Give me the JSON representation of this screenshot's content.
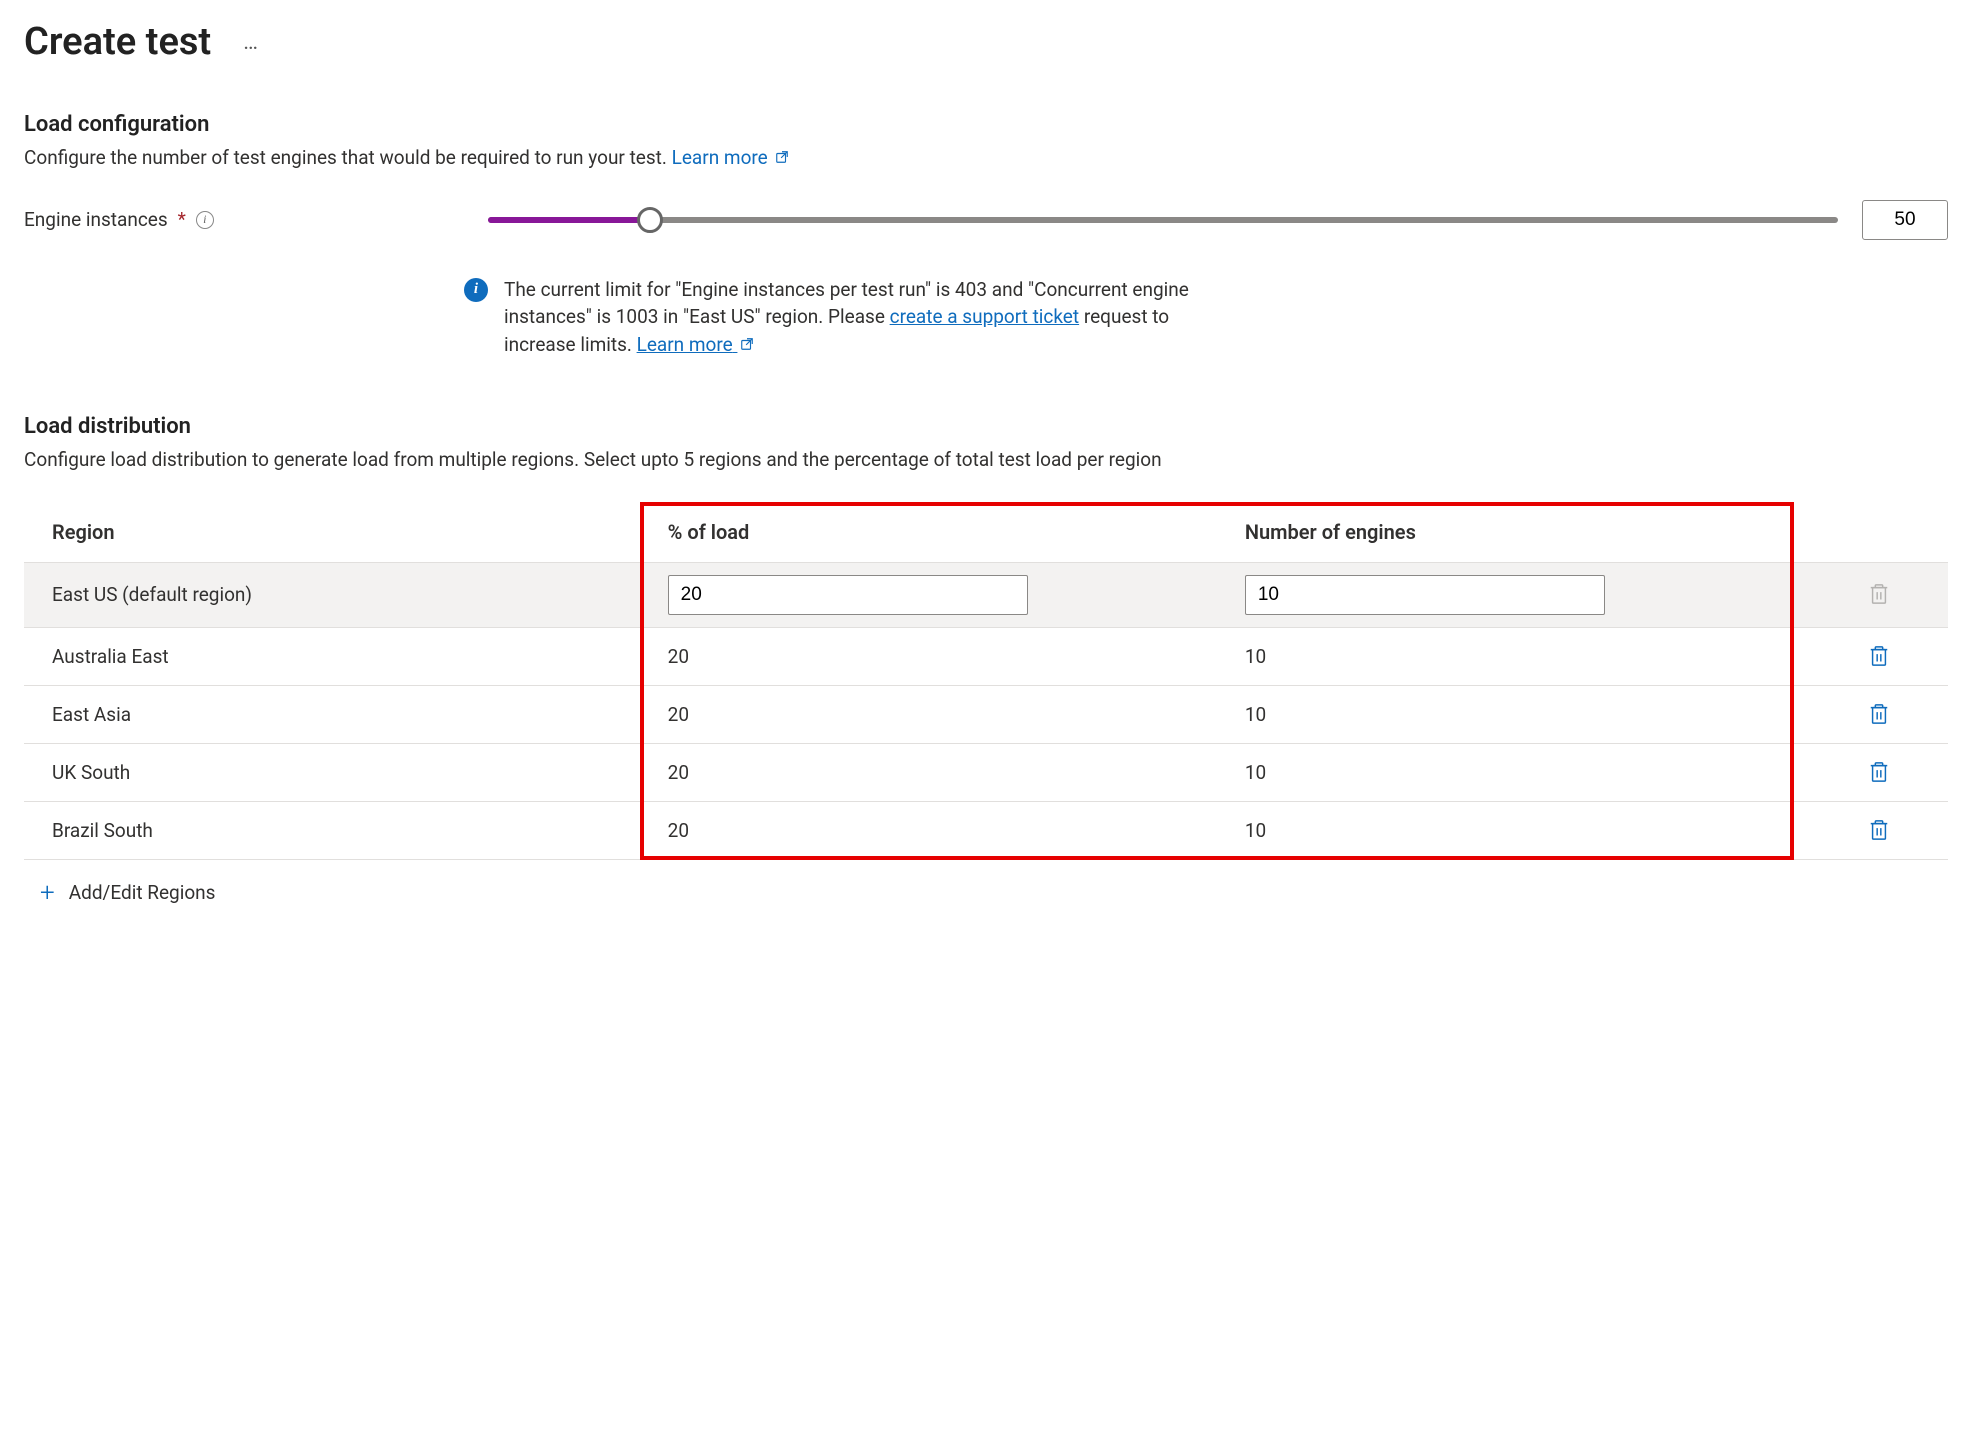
{
  "page": {
    "title": "Create test"
  },
  "loadConfig": {
    "heading": "Load configuration",
    "description": "Configure the number of test engines that would be required to run your test. ",
    "learnMoreLabel": "Learn more",
    "engineLabel": "Engine instances",
    "engineValue": "50",
    "info": {
      "prefix": "The current limit for \"Engine instances per test run\" is 403 and \"Concurrent engine instances\" is 1003 in \"East US\" region. Please ",
      "ticketLink": "create a support ticket",
      "middle": " request to increase limits. ",
      "learnMoreLabel": "Learn more"
    }
  },
  "loadDist": {
    "heading": "Load distribution",
    "description": "Configure load distribution to generate load from multiple regions. Select upto 5 regions and the percentage of total test load per region",
    "columns": {
      "region": "Region",
      "pct": "% of load",
      "engines": "Number of engines"
    },
    "rows": [
      {
        "region": "East US (default region)",
        "pct": "20",
        "engines": "10",
        "editable": true,
        "deletable": false
      },
      {
        "region": "Australia East",
        "pct": "20",
        "engines": "10",
        "editable": false,
        "deletable": true
      },
      {
        "region": "East Asia",
        "pct": "20",
        "engines": "10",
        "editable": false,
        "deletable": true
      },
      {
        "region": "UK South",
        "pct": "20",
        "engines": "10",
        "editable": false,
        "deletable": true
      },
      {
        "region": "Brazil South",
        "pct": "20",
        "engines": "10",
        "editable": false,
        "deletable": true
      }
    ],
    "addLabel": "Add/Edit Regions"
  },
  "colors": {
    "link": "#0f6cbd",
    "accent": "#881798",
    "highlightBox": "#e60000"
  }
}
